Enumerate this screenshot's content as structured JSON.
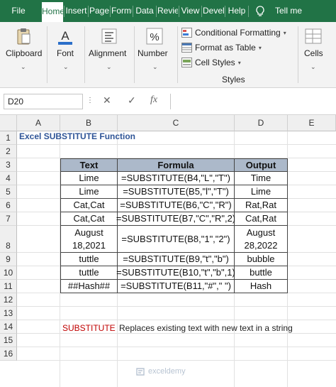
{
  "ribbon_tabs": [
    "File",
    "Home",
    "Insert",
    "Page",
    "Formulas",
    "Data",
    "Review",
    "View",
    "Developer",
    "Help",
    "Tell me"
  ],
  "ribbon_groups": {
    "clipboard": "Clipboard",
    "font": "Font",
    "alignment": "Alignment",
    "number": "Number",
    "conditional_formatting": "Conditional Formatting",
    "format_as_table": "Format as Table",
    "cell_styles": "Cell Styles",
    "styles": "Styles",
    "cells": "Cells"
  },
  "formula_bar": {
    "name_box": "D20",
    "cancel": "✕",
    "enter": "✓",
    "fx": "fx",
    "formula": ""
  },
  "columns": [
    "A",
    "B",
    "C",
    "D",
    "E"
  ],
  "rows": [
    "1",
    "2",
    "3",
    "4",
    "5",
    "6",
    "7",
    "8",
    "9",
    "10",
    "11",
    "12",
    "13",
    "14",
    "15",
    "16"
  ],
  "sheet": {
    "title": "Excel SUBSTITUTE Function",
    "table_headers": [
      "Text",
      "Formula",
      "Output"
    ],
    "table_rows": [
      [
        "Lime",
        "=SUBSTITUTE(B4,\"L\",\"T\")",
        "Time"
      ],
      [
        "Lime",
        "=SUBSTITUTE(B5,\"l\",\"T\")",
        "Lime"
      ],
      [
        "Cat,Cat",
        "=SUBSTITUTE(B6,\"C\",\"R\")",
        "Rat,Rat"
      ],
      [
        "Cat,Cat",
        "=SUBSTITUTE(B7,\"C\",\"R\",2)",
        "Cat,Rat"
      ],
      [
        "August 18,2021",
        "=SUBSTITUTE(B8,\"1\",\"2\")",
        "August 28,2022"
      ],
      [
        "tuttle",
        "=SUBSTITUTE(B9,\"t\",\"b\")",
        "bubble"
      ],
      [
        "tuttle",
        "=SUBSTITUTE(B10,\"t\",\"b\",1)",
        "buttle"
      ],
      [
        "##Hash##",
        "=SUBSTITUTE(B11,\"#\",\" \")",
        "Hash"
      ]
    ],
    "note_key": "SUBSTITUTE",
    "note_text": "Replaces existing text with new text in a string"
  },
  "watermark": "exceldemy",
  "colors": {
    "ribbon_green": "#217346",
    "header_fill": "#acb9ca",
    "title_blue": "#2f5597",
    "key_red": "#c00000"
  }
}
